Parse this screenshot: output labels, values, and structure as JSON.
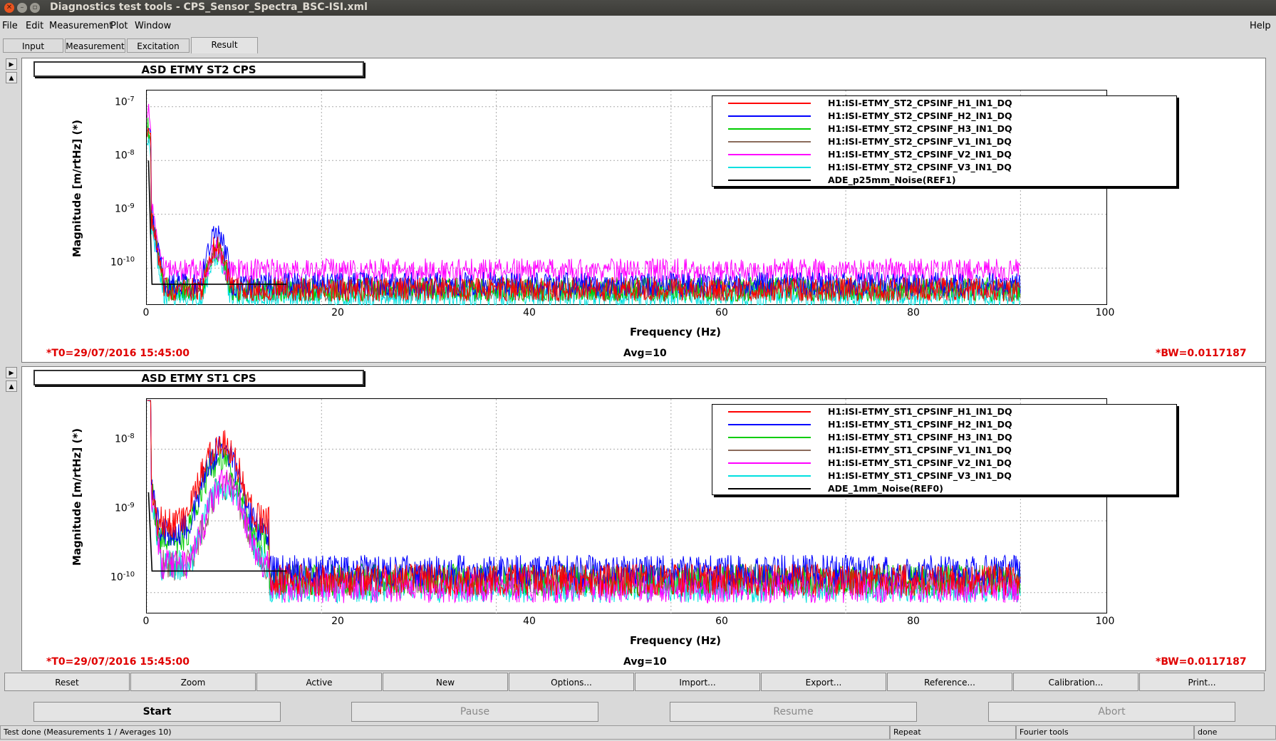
{
  "window": {
    "title": "Diagnostics test tools - CPS_Sensor_Spectra_BSC-ISI.xml"
  },
  "menu": {
    "file": "File",
    "edit": "Edit",
    "measurement": "Measurement",
    "plot": "Plot",
    "window": "Window",
    "help": "Help"
  },
  "tabs": {
    "input": "Input",
    "measurement": "Measurement",
    "excitation": "Excitation",
    "result": "Result"
  },
  "plots": [
    {
      "title": "ASD ETMY ST2 CPS",
      "ylabel": "Magnitude [m/rtHz] (*)",
      "xlabel": "Frequency (Hz)",
      "yticks": [
        "10",
        "10",
        "10",
        "10"
      ],
      "yexp": [
        "-7",
        "-8",
        "-9",
        "-10"
      ],
      "xticks": [
        "0",
        "20",
        "40",
        "60",
        "80",
        "100"
      ],
      "t0": "*T0=29/07/2016 15:45:00",
      "avg": "Avg=10",
      "bw": "*BW=0.0117187",
      "legend": [
        "H1:ISI-ETMY_ST2_CPSINF_H1_IN1_DQ",
        "H1:ISI-ETMY_ST2_CPSINF_H2_IN1_DQ",
        "H1:ISI-ETMY_ST2_CPSINF_H3_IN1_DQ",
        "H1:ISI-ETMY_ST2_CPSINF_V1_IN1_DQ",
        "H1:ISI-ETMY_ST2_CPSINF_V2_IN1_DQ",
        "H1:ISI-ETMY_ST2_CPSINF_V3_IN1_DQ",
        "ADE_p25mm_Noise(REF1)"
      ]
    },
    {
      "title": "ASD ETMY ST1 CPS",
      "ylabel": "Magnitude [m/rtHz] (*)",
      "xlabel": "Frequency (Hz)",
      "yticks": [
        "10",
        "10",
        "10"
      ],
      "yexp": [
        "-8",
        "-9",
        "-10"
      ],
      "xticks": [
        "0",
        "20",
        "40",
        "60",
        "80",
        "100"
      ],
      "t0": "*T0=29/07/2016 15:45:00",
      "avg": "Avg=10",
      "bw": "*BW=0.0117187",
      "legend": [
        "H1:ISI-ETMY_ST1_CPSINF_H1_IN1_DQ",
        "H1:ISI-ETMY_ST1_CPSINF_H2_IN1_DQ",
        "H1:ISI-ETMY_ST1_CPSINF_H3_IN1_DQ",
        "H1:ISI-ETMY_ST1_CPSINF_V1_IN1_DQ",
        "H1:ISI-ETMY_ST1_CPSINF_V2_IN1_DQ",
        "H1:ISI-ETMY_ST1_CPSINF_V3_IN1_DQ",
        "ADE_1mm_Noise(REF0)"
      ]
    }
  ],
  "series_colors": [
    "#ff0000",
    "#0000ff",
    "#00cc00",
    "#8b6b5b",
    "#ff00ff",
    "#00e0e0",
    "#000000"
  ],
  "buttons": [
    "Reset",
    "Zoom",
    "Active",
    "New",
    "Options...",
    "Import...",
    "Export...",
    "Reference...",
    "Calibration...",
    "Print..."
  ],
  "controls": {
    "start": "Start",
    "pause": "Pause",
    "resume": "Resume",
    "abort": "Abort"
  },
  "status": {
    "message": "Test done (Measurements 1 / Averages 10)",
    "repeat": "Repeat",
    "tool": "Fourier tools",
    "state": "done"
  },
  "chart_data": [
    {
      "type": "line",
      "title": "ASD ETMY ST2 CPS",
      "xlabel": "Frequency (Hz)",
      "ylabel": "Magnitude [m/rtHz] (*)",
      "xlim": [
        0,
        110
      ],
      "ylim": [
        2e-11,
        2e-07
      ],
      "yscale": "log",
      "grid": true,
      "legend_position": "top-right",
      "series": [
        {
          "name": "H1:ISI-ETMY_ST2_CPSINF_H1_IN1_DQ",
          "floor": 4e-11,
          "peak_hz": 8,
          "peak": 2.5e-10
        },
        {
          "name": "H1:ISI-ETMY_ST2_CPSINF_H2_IN1_DQ",
          "floor": 5e-11,
          "peak_hz": 8,
          "peak": 4e-10
        },
        {
          "name": "H1:ISI-ETMY_ST2_CPSINF_H3_IN1_DQ",
          "floor": 4e-11,
          "peak_hz": 8,
          "peak": 2e-10
        },
        {
          "name": "H1:ISI-ETMY_ST2_CPSINF_V1_IN1_DQ",
          "floor": 4e-11,
          "peak_hz": 8,
          "peak": 2e-10
        },
        {
          "name": "H1:ISI-ETMY_ST2_CPSINF_V2_IN1_DQ",
          "floor": 9e-11,
          "peak_hz": 8,
          "peak": 2e-10
        },
        {
          "name": "H1:ISI-ETMY_ST2_CPSINF_V3_IN1_DQ",
          "floor": 3e-11,
          "peak_hz": 8,
          "peak": 1.5e-10
        },
        {
          "name": "ADE_p25mm_Noise(REF1)",
          "floor": 5e-11
        }
      ]
    },
    {
      "type": "line",
      "title": "ASD ETMY ST1 CPS",
      "xlabel": "Frequency (Hz)",
      "ylabel": "Magnitude [m/rtHz] (*)",
      "xlim": [
        0,
        110
      ],
      "ylim": [
        5e-11,
        5e-08
      ],
      "yscale": "log",
      "grid": true,
      "legend_position": "top-right",
      "series": [
        {
          "name": "H1:ISI-ETMY_ST1_CPSINF_H1_IN1_DQ",
          "floor": 1.5e-10,
          "peak_hz": 8.5,
          "peak": 1.2e-08
        },
        {
          "name": "H1:ISI-ETMY_ST1_CPSINF_H2_IN1_DQ",
          "floor": 2e-10,
          "peak_hz": 8.5,
          "peak": 9e-09
        },
        {
          "name": "H1:ISI-ETMY_ST1_CPSINF_H3_IN1_DQ",
          "floor": 1.5e-10,
          "peak_hz": 8.5,
          "peak": 7e-09
        },
        {
          "name": "H1:ISI-ETMY_ST1_CPSINF_V1_IN1_DQ",
          "floor": 1.5e-10,
          "peak_hz": 9,
          "peak": 3e-09
        },
        {
          "name": "H1:ISI-ETMY_ST1_CPSINF_V2_IN1_DQ",
          "floor": 1.2e-10,
          "peak_hz": 9,
          "peak": 3e-09
        },
        {
          "name": "H1:ISI-ETMY_ST1_CPSINF_V3_IN1_DQ",
          "floor": 1.2e-10,
          "peak_hz": 9,
          "peak": 3e-09
        },
        {
          "name": "ADE_1mm_Noise(REF0)",
          "floor": 2e-10
        }
      ]
    }
  ]
}
